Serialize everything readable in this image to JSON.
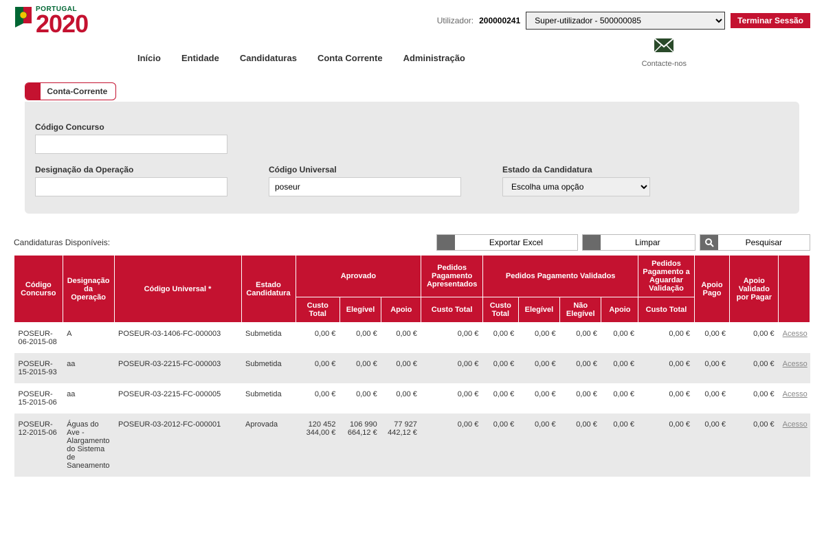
{
  "header": {
    "portugal": "PORTUGAL",
    "year": "2020",
    "user_label": "Utilizador:",
    "user_value": "200000241",
    "role_selected": "Super-utilizador - 500000085",
    "logout": "Terminar Sessão",
    "contact": "Contacte-nos"
  },
  "nav": {
    "inicio": "Início",
    "entidade": "Entidade",
    "candidaturas": "Candidaturas",
    "conta": "Conta Corrente",
    "admin": "Administração"
  },
  "tab": {
    "label": "Conta-Corrente"
  },
  "filters": {
    "codigo_concurso_label": "Código Concurso",
    "codigo_concurso_value": "",
    "designacao_label": "Designação da Operação",
    "designacao_value": "",
    "codigo_universal_label": "Código Universal",
    "codigo_universal_value": "poseur",
    "estado_label": "Estado da Candidatura",
    "estado_selected": "Escolha uma opção"
  },
  "actions": {
    "available": "Candidaturas Disponíveis:",
    "export": "Exportar Excel",
    "clear": "Limpar",
    "search": "Pesquisar"
  },
  "table": {
    "h_codigo": "Código Concurso",
    "h_desig": "Designação da Operação",
    "h_univ": "Código Universal *",
    "h_estado": "Estado Candidatura",
    "h_aprovado": "Aprovado",
    "h_aprov_ct": "Custo Total",
    "h_aprov_el": "Elegível",
    "h_aprov_ap": "Apoio",
    "h_ppa": "Pedidos Pagamento Apresentados",
    "h_ppa_ct": "Custo Total",
    "h_ppv": "Pedidos Pagamento Validados",
    "h_ppv_ct": "Custo Total",
    "h_ppv_el": "Elegível",
    "h_ppv_ne": "Não Elegível",
    "h_ppv_ap": "Apoio",
    "h_ppag": "Pedidos Pagamento a Aguardar Validação",
    "h_ppag_ct": "Custo Total",
    "h_apago": "Apoio Pago",
    "h_avpp": "Apoio Validado por Pagar",
    "h_acc": "",
    "acesso": "Acesso"
  },
  "rows": [
    {
      "codigo": "POSEUR-06-2015-08",
      "desig": "A",
      "univ": "POSEUR-03-1406-FC-000003",
      "estado": "Submetida",
      "ct": "0,00 €",
      "el": "0,00 €",
      "ap": "0,00 €",
      "ppa": "0,00 €",
      "vct": "0,00 €",
      "vel": "0,00 €",
      "vne": "0,00 €",
      "vap": "0,00 €",
      "agct": "0,00 €",
      "apago": "0,00 €",
      "avpp": "0,00 €"
    },
    {
      "codigo": "POSEUR-15-2015-93",
      "desig": "aa",
      "univ": "POSEUR-03-2215-FC-000003",
      "estado": "Submetida",
      "ct": "0,00 €",
      "el": "0,00 €",
      "ap": "0,00 €",
      "ppa": "0,00 €",
      "vct": "0,00 €",
      "vel": "0,00 €",
      "vne": "0,00 €",
      "vap": "0,00 €",
      "agct": "0,00 €",
      "apago": "0,00 €",
      "avpp": "0,00 €"
    },
    {
      "codigo": "POSEUR-15-2015-06",
      "desig": "aa",
      "univ": "POSEUR-03-2215-FC-000005",
      "estado": "Submetida",
      "ct": "0,00 €",
      "el": "0,00 €",
      "ap": "0,00 €",
      "ppa": "0,00 €",
      "vct": "0,00 €",
      "vel": "0,00 €",
      "vne": "0,00 €",
      "vap": "0,00 €",
      "agct": "0,00 €",
      "apago": "0,00 €",
      "avpp": "0,00 €"
    },
    {
      "codigo": "POSEUR-12-2015-06",
      "desig": "Águas do Ave - Alargamento do Sistema de Saneamento",
      "univ": "POSEUR-03-2012-FC-000001",
      "estado": "Aprovada",
      "ct": "120 452 344,00 €",
      "el": "106 990 664,12 €",
      "ap": "77 927 442,12 €",
      "ppa": "0,00 €",
      "vct": "0,00 €",
      "vel": "0,00 €",
      "vne": "0,00 €",
      "vap": "0,00 €",
      "agct": "0,00 €",
      "apago": "0,00 €",
      "avpp": "0,00 €"
    }
  ]
}
